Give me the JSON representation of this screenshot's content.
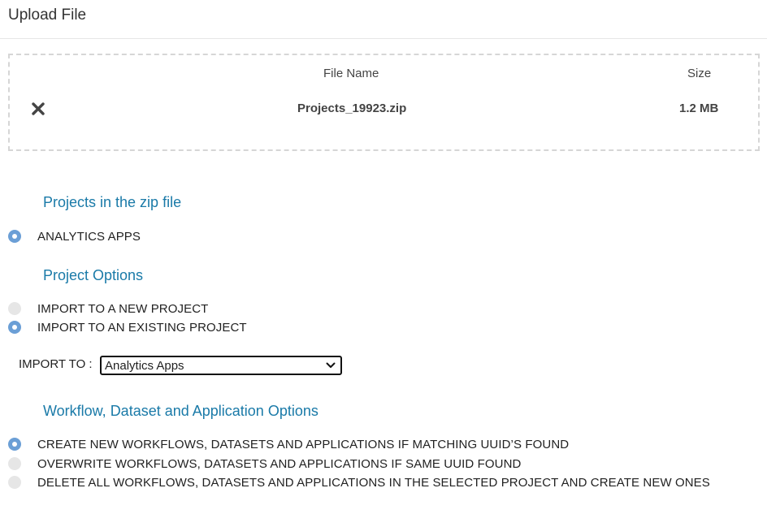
{
  "header": {
    "title": "Upload File"
  },
  "upload_table": {
    "columns": {
      "name": "File Name",
      "size": "Size"
    },
    "file": {
      "name": "Projects_19923.zip",
      "size": "1.2 MB",
      "remove_icon": "close-x-icon"
    }
  },
  "projects_section": {
    "title": "Projects in the zip file",
    "items": [
      {
        "label": "ANALYTICS APPS",
        "selected": true
      }
    ]
  },
  "project_options": {
    "title": "Project Options",
    "options": [
      {
        "label": "IMPORT TO A NEW PROJECT",
        "selected": false
      },
      {
        "label": "IMPORT TO AN EXISTING PROJECT",
        "selected": true
      }
    ],
    "import_to": {
      "label": "IMPORT TO :",
      "selected_value": "Analytics Apps"
    }
  },
  "workflow_options": {
    "title": "Workflow, Dataset and Application Options",
    "options": [
      {
        "label": "CREATE NEW WORKFLOWS, DATASETS AND APPLICATIONS IF MATCHING UUID’S FOUND",
        "selected": true
      },
      {
        "label": "OVERWRITE WORKFLOWS, DATASETS AND APPLICATIONS IF SAME UUID FOUND",
        "selected": false
      },
      {
        "label": "DELETE ALL WORKFLOWS, DATASETS AND APPLICATIONS IN THE SELECTED PROJECT AND CREATE NEW ONES",
        "selected": false
      }
    ]
  },
  "colors": {
    "section_title": "#1a7aa8",
    "radio_selected": "#6b9fd6",
    "radio_unselected": "#e6e6e6",
    "dropzone_border": "#d6d6d6"
  }
}
